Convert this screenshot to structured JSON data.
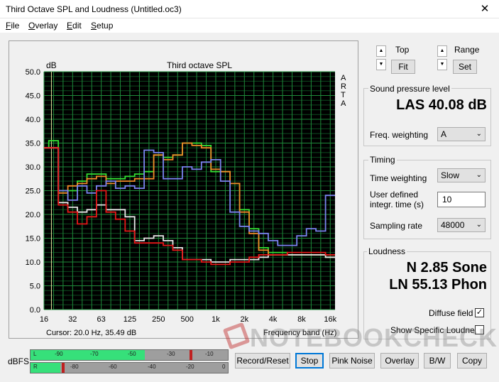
{
  "window": {
    "title": "Third Octave SPL and Loudness (Untitled.oc3)",
    "close_glyph": "✕"
  },
  "menu": [
    {
      "accel": "F",
      "rest": "ile"
    },
    {
      "accel": "O",
      "rest": "verlay"
    },
    {
      "accel": "E",
      "rest": "dit"
    },
    {
      "accel": "S",
      "rest": "etup"
    }
  ],
  "plot": {
    "unit_label": "dB",
    "side_label": [
      "A",
      "R",
      "T",
      "A"
    ],
    "cursor_text": "Cursor:     20.0 Hz, 35.49 dB"
  },
  "chart_data": {
    "type": "line",
    "title": "Third octave SPL",
    "xlabel": "Frequency band (Hz)",
    "ylabel": "dB",
    "ylim": [
      0,
      50
    ],
    "yticks": [
      "0.0",
      "5.0",
      "10.0",
      "15.0",
      "20.0",
      "25.0",
      "30.0",
      "35.0",
      "40.0",
      "45.0",
      "50.0"
    ],
    "xticks": [
      "16",
      "32",
      "63",
      "125",
      "250",
      "500",
      "1k",
      "2k",
      "4k",
      "8k",
      "16k"
    ],
    "bands": [
      "16",
      "20",
      "25",
      "31.5",
      "40",
      "50",
      "63",
      "80",
      "100",
      "125",
      "160",
      "200",
      "250",
      "315",
      "400",
      "500",
      "630",
      "800",
      "1k",
      "1.25k",
      "1.6k",
      "2k",
      "2.5k",
      "3.15k",
      "4k",
      "5k",
      "6.3k",
      "8k",
      "10k",
      "12.5k",
      "16k",
      "20k"
    ],
    "grid": true,
    "series": [
      {
        "name": "",
        "color": "#33e033",
        "values": [
          34,
          35.5,
          25,
          25,
          27,
          28.5,
          28.5,
          27.5,
          27.5,
          28,
          28.5,
          29,
          32.5,
          32,
          32.5,
          35,
          35,
          34.5,
          29,
          29,
          26.5,
          21,
          17,
          13,
          12,
          12,
          11.5,
          11.5,
          11.5,
          11.5,
          11,
          11
        ]
      },
      {
        "name": "",
        "color": "#f08a28",
        "values": [
          34,
          34,
          24.5,
          26,
          26.5,
          27.5,
          28,
          26.5,
          27,
          27,
          27.5,
          27.5,
          32.5,
          31.5,
          32.5,
          35,
          34.5,
          34,
          29.5,
          29,
          26.5,
          20.5,
          16,
          12.5,
          11.5,
          11.5,
          11.5,
          11.5,
          11.5,
          11.5,
          11.5,
          11.5
        ]
      },
      {
        "name": "",
        "color": "#7a84f0",
        "values": [
          34,
          34,
          25,
          23,
          26,
          24.5,
          26,
          27,
          25.5,
          26,
          25.5,
          33.5,
          33,
          27.5,
          27.5,
          30,
          29.5,
          31,
          31.5,
          27,
          20.5,
          17.5,
          16.5,
          16,
          14.5,
          13.5,
          13.5,
          15.5,
          17,
          16.5,
          24,
          24
        ]
      },
      {
        "name": "",
        "color": "#e8e8e8",
        "values": [
          34,
          34,
          22.5,
          21.5,
          20.5,
          21,
          22,
          21,
          21,
          19.5,
          14.5,
          15,
          15.5,
          14.5,
          13,
          10.5,
          10.5,
          10.5,
          10,
          10,
          10.5,
          10.5,
          10.5,
          11,
          11.5,
          11.5,
          11.5,
          11.5,
          11.5,
          11.5,
          11,
          11
        ]
      },
      {
        "name": "",
        "color": "#e81818",
        "values": [
          34,
          34,
          22,
          20.5,
          18,
          19.5,
          25,
          20.5,
          19,
          16.5,
          14,
          14,
          14,
          13.5,
          12.5,
          10.5,
          10.5,
          10,
          9.5,
          9.5,
          10,
          10,
          11,
          11.5,
          11.5,
          11.5,
          12,
          12,
          12,
          12,
          11.5,
          11.5
        ]
      }
    ]
  },
  "controls": {
    "top_label": "Top",
    "range_label": "Range",
    "fit_label": "Fit",
    "set_label": "Set",
    "up_glyph": "▲",
    "down_glyph": "▼"
  },
  "spl": {
    "group": "Sound pressure level",
    "reading": "LAS 40.08 dB",
    "freq_weighting_label": "Freq. weighting",
    "freq_weighting_value": "A"
  },
  "timing": {
    "group": "Timing",
    "time_weighting_label": "Time weighting",
    "time_weighting_value": "Slow",
    "user_integr_label_1": "User defined",
    "user_integr_label_2": "integr. time (s)",
    "user_integr_value": "10",
    "sampling_rate_label": "Sampling rate",
    "sampling_rate_value": "48000"
  },
  "loudness": {
    "group": "Loudness",
    "sone": "N 2.85 Sone",
    "phon": "LN 55.13 Phon",
    "diffuse_label": "Diffuse field",
    "diffuse_checked": "✓",
    "specific_label": "Show Specific Loudness"
  },
  "meter": {
    "label": "dBFS",
    "top_ticks": [
      "L",
      "-90",
      "-70",
      "-50",
      "-30",
      "-10"
    ],
    "bottom_ticks": [
      "R",
      "-80",
      "-60",
      "-40",
      "-20",
      "0"
    ],
    "level_fraction_top": 0.58,
    "level_fraction_bottom": 0.15
  },
  "buttons": {
    "record_reset": "Record/Reset",
    "stop": "Stop",
    "pink_noise": "Pink Noise",
    "overlay": "Overlay",
    "bw": "B/W",
    "copy": "Copy"
  },
  "watermark": "NOTEBOOKCHECK",
  "chev": "⌄"
}
